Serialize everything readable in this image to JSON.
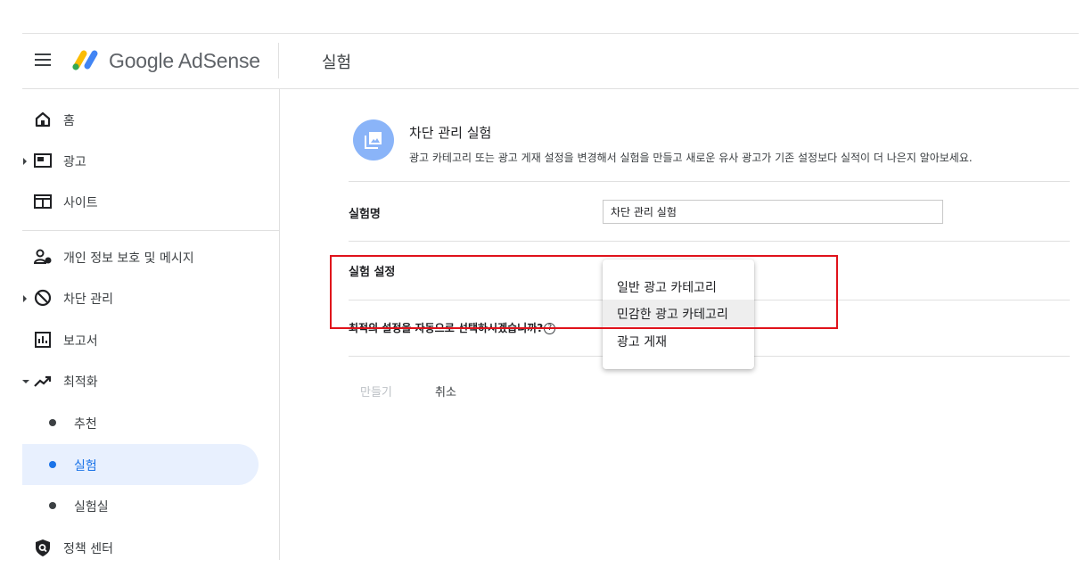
{
  "header": {
    "app_name": "Google AdSense",
    "page_title": "실험"
  },
  "sidebar": {
    "items": [
      {
        "label": "홈",
        "icon": "home-icon"
      },
      {
        "label": "광고",
        "icon": "ads-icon",
        "caret": "collapsed"
      },
      {
        "label": "사이트",
        "icon": "sites-icon"
      },
      {
        "label": "개인 정보 보호 및 메시지",
        "icon": "privacy-icon"
      },
      {
        "label": "차단 관리",
        "icon": "block-icon",
        "caret": "collapsed"
      },
      {
        "label": "보고서",
        "icon": "reports-icon"
      },
      {
        "label": "최적화",
        "icon": "trending-icon",
        "caret": "expanded"
      }
    ],
    "sub_items": [
      {
        "label": "추천",
        "active": false
      },
      {
        "label": "실험",
        "active": true
      },
      {
        "label": "실험실",
        "active": false
      }
    ],
    "policy": {
      "label": "정책 센터",
      "icon": "policy-icon"
    }
  },
  "main": {
    "experiment_title": "차단 관리 실험",
    "experiment_desc": "광고 카테고리 또는 광고 게재 설정을 변경해서 실험을 만들고 새로운 유사 광고가 기존 설정보다 실적이 더 나은지 알아보세요.",
    "name_label": "실험명",
    "name_value": "차단 관리 실험",
    "settings_label": "실험 설정",
    "optimal_label": "최적의 설정을 자동으로 선택하시겠습니까?",
    "create_label": "만들기",
    "cancel_label": "취소"
  },
  "dropdown": {
    "options": [
      "일반 광고 카테고리",
      "민감한 광고 카테고리",
      "광고 게재"
    ],
    "hovered_index": 1
  },
  "colors": {
    "accent": "#1a73e8",
    "active_bg": "#e8f0fe",
    "highlight_border": "#e0121b",
    "icon_circle": "#8ab4f8"
  }
}
